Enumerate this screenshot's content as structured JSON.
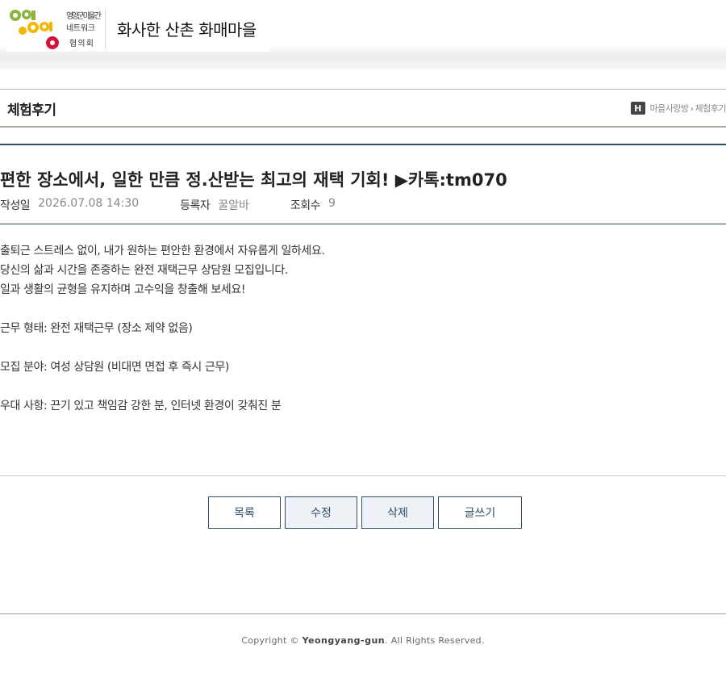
{
  "header": {
    "logo_lines": [
      "영양군 마을 간",
      "네트워크",
      "협의회"
    ],
    "site_title": "화사한 산촌 화매마을",
    "logo_colors": {
      "green": "#8cb43c",
      "yellow": "#f2b705",
      "red": "#d2143c"
    }
  },
  "board": {
    "title": "체험후기",
    "breadcrumb": {
      "home_icon_letter": "H",
      "items": [
        "마을사랑방",
        "체험후기"
      ],
      "separator": "›"
    }
  },
  "post": {
    "title": "편한 장소에서, 일한 만큼 정.산받는 최고의 재택 기회! ▶카톡:tm070",
    "meta": {
      "date_label": "작성일",
      "date_value": "2026.07.08 14:30",
      "author_label": "등록자",
      "author_value": "꿀알바",
      "views_label": "조회수",
      "views_value": "9"
    },
    "body_lines": [
      "출퇴근 스트레스 없이, 내가 원하는 편안한 환경에서 자유롭게 일하세요.",
      "당신의 삶과 시간을 존중하는 완전 재택근무 상담원 모집입니다.",
      "일과 생활의 균형을 유지하며 고수익을 창출해 보세요!",
      "",
      "근무 형태: 완전 재택근무 (장소 제약 없음)",
      "",
      "모집 분야: 여성 상담원 (비대면 면접 후 즉시 근무)",
      "",
      "우대 사항: 끈기 있고 책임감 강한 분, 인터넷 환경이 갖춰진 분"
    ]
  },
  "buttons": {
    "list": "목록",
    "edit": "수정",
    "delete": "삭제",
    "write": "글쓰기"
  },
  "footer": {
    "copyright_prefix": "Copyright © ",
    "copyright_brand": "Yeongyang-gun",
    "copyright_suffix": ". All Rights Reserved."
  },
  "colors": {
    "accent": "#2f4f67",
    "button_alt_bg": "#eef2f7"
  }
}
